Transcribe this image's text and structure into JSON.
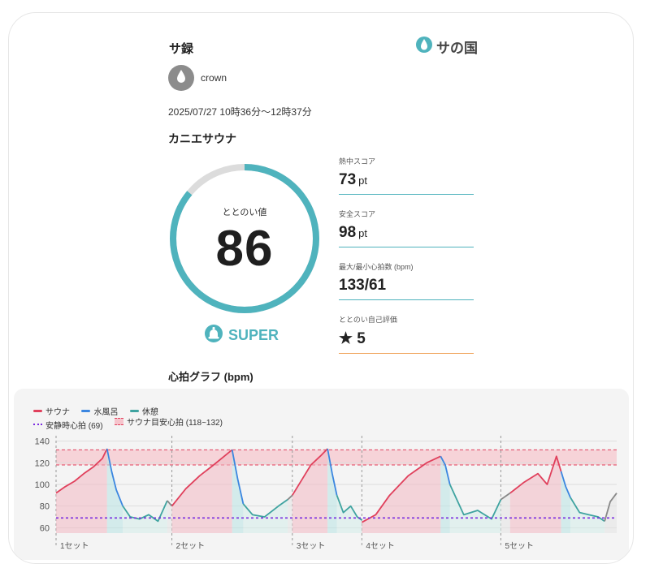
{
  "header": {
    "title": "サ録",
    "logo_text": "サの国",
    "logo_icon": "water-drop-icon"
  },
  "user": {
    "name": "crown",
    "avatar_icon": "water-drop-icon"
  },
  "session": {
    "datetime": "2025/07/27 10時36分〜12時37分",
    "facility": "カニエサウナ"
  },
  "totonoi": {
    "label": "ととのい値",
    "value": "86",
    "progress": 0.86,
    "rank": "SUPER",
    "rank_icon": "bell-icon",
    "accent": "#4fb3bd"
  },
  "stats": [
    {
      "label": "熱中スコア",
      "value": "73",
      "unit": "pt"
    },
    {
      "label": "安全スコア",
      "value": "98",
      "unit": "pt"
    },
    {
      "label": "最大/最小心拍数 (bpm)",
      "value": "133/61",
      "unit": ""
    },
    {
      "label": "ととのい自己評価",
      "value": "★ 5",
      "unit": ""
    }
  ],
  "heart_rate": {
    "title": "心拍グラフ (bpm)",
    "legend": {
      "sauna": "サウナ",
      "water": "水風呂",
      "rest": "休憩",
      "resting_hr": "安静時心拍 (69)",
      "target_band": "サウナ目安心拍 (118~132)"
    },
    "colors": {
      "sauna": "#e0405c",
      "water": "#3b86e0",
      "rest": "#3fa3a0",
      "other": "#888888",
      "resting": "#7a2be0"
    }
  },
  "chart_data": {
    "type": "line",
    "ylabel": "",
    "ylim": [
      55,
      145
    ],
    "yticks": [
      60,
      80,
      100,
      120,
      140
    ],
    "resting_hr": 69,
    "target_band": [
      118,
      132
    ],
    "set_labels": [
      "1セット",
      "2セット",
      "3セット",
      "4セット",
      "5セット"
    ],
    "set_starts": [
      0,
      125,
      255,
      330,
      480
    ],
    "total": 605,
    "segments": [
      {
        "phase": "sauna",
        "x": [
          0,
          10,
          20,
          30,
          40,
          50,
          55
        ],
        "y": [
          92,
          98,
          103,
          110,
          116,
          124,
          133
        ]
      },
      {
        "phase": "water",
        "x": [
          55,
          60,
          65,
          72
        ],
        "y": [
          133,
          112,
          95,
          80
        ]
      },
      {
        "phase": "rest",
        "x": [
          72,
          80,
          90,
          100,
          110,
          120
        ],
        "y": [
          80,
          70,
          68,
          72,
          66,
          85
        ]
      },
      {
        "phase": "other",
        "x": [
          120,
          125
        ],
        "y": [
          85,
          80
        ]
      },
      {
        "phase": "sauna",
        "x": [
          125,
          140,
          155,
          170,
          180,
          190
        ],
        "y": [
          80,
          96,
          108,
          118,
          125,
          132
        ]
      },
      {
        "phase": "water",
        "x": [
          190,
          196,
          202
        ],
        "y": [
          132,
          105,
          82
        ]
      },
      {
        "phase": "rest",
        "x": [
          202,
          212,
          225,
          240,
          250
        ],
        "y": [
          82,
          72,
          70,
          80,
          86
        ]
      },
      {
        "phase": "other",
        "x": [
          250,
          255
        ],
        "y": [
          86,
          90
        ]
      },
      {
        "phase": "sauna",
        "x": [
          255,
          265,
          275,
          285,
          293
        ],
        "y": [
          90,
          104,
          118,
          126,
          133
        ]
      },
      {
        "phase": "water",
        "x": [
          293,
          298,
          303
        ],
        "y": [
          133,
          110,
          90
        ]
      },
      {
        "phase": "rest",
        "x": [
          303,
          310,
          318,
          325,
          330
        ],
        "y": [
          90,
          74,
          80,
          70,
          67
        ]
      },
      {
        "phase": "sauna",
        "x": [
          330,
          345,
          360,
          380,
          400,
          415
        ],
        "y": [
          65,
          72,
          90,
          108,
          120,
          126
        ]
      },
      {
        "phase": "water",
        "x": [
          415,
          420,
          425
        ],
        "y": [
          126,
          118,
          100
        ]
      },
      {
        "phase": "rest",
        "x": [
          425,
          440,
          455,
          470,
          480
        ],
        "y": [
          100,
          72,
          76,
          68,
          86
        ]
      },
      {
        "phase": "other",
        "x": [
          480,
          490
        ],
        "y": [
          86,
          92
        ]
      },
      {
        "phase": "sauna",
        "x": [
          490,
          505,
          520,
          530,
          540,
          545
        ],
        "y": [
          92,
          102,
          110,
          100,
          126,
          112
        ]
      },
      {
        "phase": "water",
        "x": [
          545,
          550,
          555
        ],
        "y": [
          112,
          98,
          88
        ]
      },
      {
        "phase": "rest",
        "x": [
          555,
          565,
          575,
          585,
          592
        ],
        "y": [
          88,
          74,
          72,
          70,
          66
        ]
      },
      {
        "phase": "other",
        "x": [
          592,
          598,
          605
        ],
        "y": [
          66,
          84,
          92
        ]
      }
    ]
  }
}
